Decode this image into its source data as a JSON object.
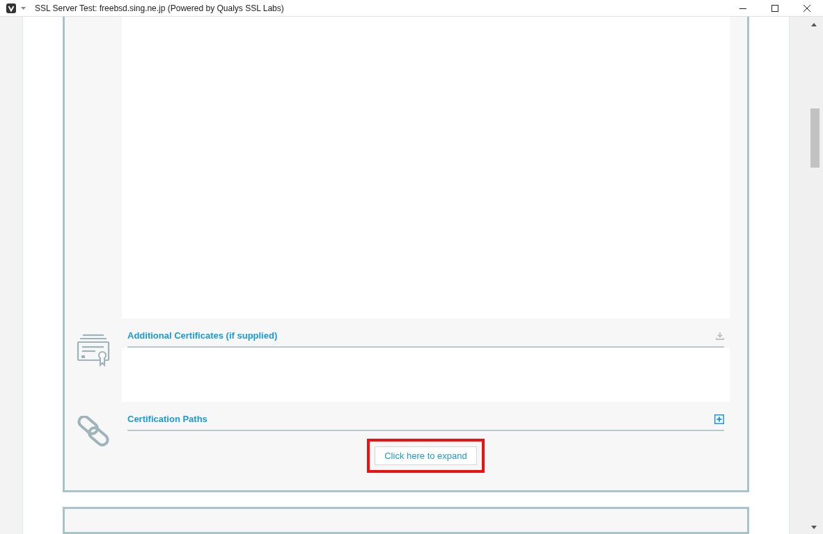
{
  "window": {
    "title": "SSL Server Test: freebsd.sing.ne.jp (Powered by Qualys SSL Labs)"
  },
  "sections": [
    {
      "title": "Additional Certificates (if supplied)",
      "kind": "certificate"
    },
    {
      "title": "Certification Paths",
      "kind": "paths"
    }
  ],
  "expand_button": {
    "label": "Click here to expand",
    "highlighted": true
  }
}
